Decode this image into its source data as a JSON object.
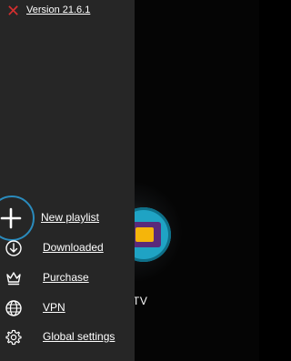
{
  "header": {
    "version": "Version 21.6.1",
    "close_icon": "close-x-icon",
    "close_color": "#d32f2f"
  },
  "menu": {
    "items": [
      {
        "label": "New playlist",
        "icon": "plus-icon"
      },
      {
        "label": "Downloaded",
        "icon": "download-circle-icon"
      },
      {
        "label": "Purchase",
        "icon": "crown-icon"
      },
      {
        "label": "VPN",
        "icon": "globe-icon"
      },
      {
        "label": "Global settings",
        "icon": "gear-icon"
      }
    ]
  },
  "background": {
    "app_label": "TV"
  },
  "colors": {
    "drawer_bg": "#262626",
    "accent_ring": "#2a8bbd",
    "text": "#ffffff"
  }
}
